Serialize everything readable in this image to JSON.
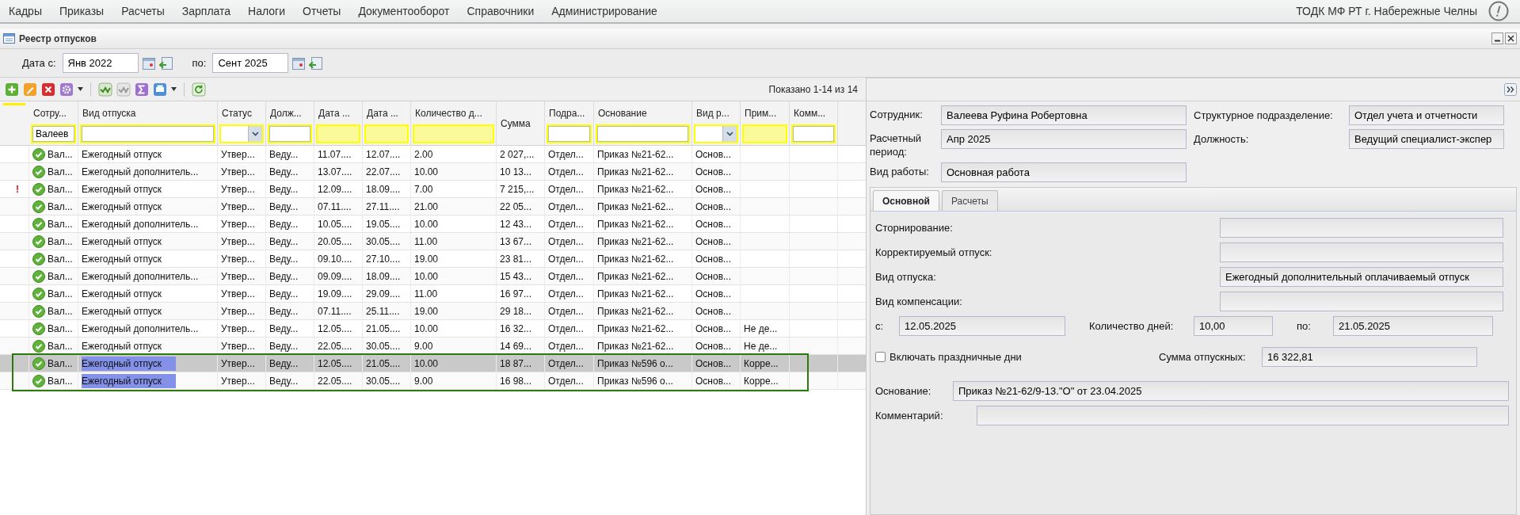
{
  "menu": {
    "items": [
      "Кадры",
      "Приказы",
      "Расчеты",
      "Зарплата",
      "Налоги",
      "Отчеты",
      "Документооборот",
      "Справочники",
      "Администрирование"
    ],
    "organization": "ТОДК МФ РТ г. Набережные Челны"
  },
  "window": {
    "title": "Реестр отпусков"
  },
  "period": {
    "from_label": "Дата с:",
    "from_value": "Янв 2022",
    "to_label": "по:",
    "to_value": "Сент 2025"
  },
  "table": {
    "shown": "Показано 1-14 из 14",
    "columns": [
      {
        "title": "Сотру...",
        "filter": {
          "kind": "text",
          "value": "Валеев"
        }
      },
      {
        "title": "Вид отпуска",
        "filter": {
          "kind": "text"
        }
      },
      {
        "title": "Статус",
        "filter": {
          "kind": "select"
        }
      },
      {
        "title": "Долж...",
        "filter": {
          "kind": "text"
        }
      },
      {
        "title": "Дата ...",
        "filter": {
          "kind": "shaded"
        }
      },
      {
        "title": "Дата ...",
        "filter": {
          "kind": "shaded"
        }
      },
      {
        "title": "Количество д...",
        "filter": {
          "kind": "shaded"
        }
      },
      {
        "title": "Сумма"
      },
      {
        "title": "Подра...",
        "filter": {
          "kind": "text"
        }
      },
      {
        "title": "Основание",
        "filter": {
          "kind": "text"
        }
      },
      {
        "title": "Вид р...",
        "filter": {
          "kind": "select"
        }
      },
      {
        "title": "Прим...",
        "filter": {
          "kind": "shaded"
        }
      },
      {
        "title": "Комм...",
        "filter": {
          "kind": "text"
        }
      }
    ],
    "rows": [
      {
        "selected": false,
        "highlighted": false,
        "framed": false,
        "cells": [
          "Вал...",
          "Ежегодный отпуск",
          "Утвер...",
          "Веду...",
          "11.07....",
          "12.07....",
          "2.00",
          "2 027,...",
          "Отдел...",
          "Приказ №21-62...",
          "Основ..."
        ]
      },
      {
        "selected": false,
        "highlighted": false,
        "framed": false,
        "cells": [
          "Вал...",
          "Ежегодный дополнитель...",
          "Утвер...",
          "Веду...",
          "13.07....",
          "22.07....",
          "10.00",
          "10 13...",
          "Отдел...",
          "Приказ №21-62...",
          "Основ..."
        ]
      },
      {
        "selected": false,
        "highlighted": false,
        "framed": false,
        "marker": "!",
        "cells": [
          "Вал...",
          "Ежегодный отпуск",
          "Утвер...",
          "Веду...",
          "12.09....",
          "18.09....",
          "7.00",
          "7 215,...",
          "Отдел...",
          "Приказ №21-62...",
          "Основ..."
        ]
      },
      {
        "selected": false,
        "highlighted": false,
        "framed": false,
        "cells": [
          "Вал...",
          "Ежегодный отпуск",
          "Утвер...",
          "Веду...",
          "07.11....",
          "27.11....",
          "21.00",
          "22 05...",
          "Отдел...",
          "Приказ №21-62...",
          "Основ..."
        ]
      },
      {
        "selected": false,
        "highlighted": false,
        "framed": false,
        "cells": [
          "Вал...",
          "Ежегодный дополнитель...",
          "Утвер...",
          "Веду...",
          "10.05....",
          "19.05....",
          "10.00",
          "12 43...",
          "Отдел...",
          "Приказ №21-62...",
          "Основ..."
        ]
      },
      {
        "selected": false,
        "highlighted": false,
        "framed": false,
        "cells": [
          "Вал...",
          "Ежегодный отпуск",
          "Утвер...",
          "Веду...",
          "20.05....",
          "30.05....",
          "11.00",
          "13 67...",
          "Отдел...",
          "Приказ №21-62...",
          "Основ..."
        ]
      },
      {
        "selected": false,
        "highlighted": false,
        "framed": false,
        "cells": [
          "Вал...",
          "Ежегодный отпуск",
          "Утвер...",
          "Веду...",
          "09.10....",
          "27.10....",
          "19.00",
          "23 81...",
          "Отдел...",
          "Приказ №21-62...",
          "Основ..."
        ]
      },
      {
        "selected": false,
        "highlighted": false,
        "framed": false,
        "cells": [
          "Вал...",
          "Ежегодный дополнитель...",
          "Утвер...",
          "Веду...",
          "09.09....",
          "18.09....",
          "10.00",
          "15 43...",
          "Отдел...",
          "Приказ №21-62...",
          "Основ..."
        ]
      },
      {
        "selected": false,
        "highlighted": false,
        "framed": false,
        "cells": [
          "Вал...",
          "Ежегодный отпуск",
          "Утвер...",
          "Веду...",
          "19.09....",
          "29.09....",
          "11.00",
          "16 97...",
          "Отдел...",
          "Приказ №21-62...",
          "Основ..."
        ]
      },
      {
        "selected": false,
        "highlighted": false,
        "framed": false,
        "cells": [
          "Вал...",
          "Ежегодный отпуск",
          "Утвер...",
          "Веду...",
          "07.11....",
          "25.11....",
          "19.00",
          "29 18...",
          "Отдел...",
          "Приказ №21-62...",
          "Основ..."
        ]
      },
      {
        "selected": false,
        "highlighted": false,
        "framed": false,
        "cells": [
          "Вал...",
          "Ежегодный дополнитель...",
          "Утвер...",
          "Веду...",
          "12.05....",
          "21.05....",
          "10.00",
          "16 32...",
          "Отдел...",
          "Приказ №21-62...",
          "Основ...",
          "Не де..."
        ]
      },
      {
        "selected": false,
        "highlighted": false,
        "framed": false,
        "cells": [
          "Вал...",
          "Ежегодный отпуск",
          "Утвер...",
          "Веду...",
          "22.05....",
          "30.05....",
          "9.00",
          "14 69...",
          "Отдел...",
          "Приказ №21-62...",
          "Основ...",
          "Не де..."
        ]
      },
      {
        "selected": true,
        "highlighted": true,
        "framed": true,
        "cells": [
          "Вал...",
          "Ежегодный отпуск",
          "Утвер...",
          "Веду...",
          "12.05....",
          "21.05....",
          "10.00",
          "18 87...",
          "Отдел...",
          "Приказ №596 о...",
          "Основ...",
          "Корре..."
        ]
      },
      {
        "selected": false,
        "highlighted": true,
        "framed": true,
        "cells": [
          "Вал...",
          "Ежегодный отпуск",
          "Утвер...",
          "Веду...",
          "22.05....",
          "30.05....",
          "9.00",
          "16 98...",
          "Отдел...",
          "Приказ №596 о...",
          "Основ...",
          "Корре..."
        ]
      }
    ]
  },
  "details": {
    "header": [
      {
        "label": "Сотрудник:",
        "value": "Валеева Руфина Робертовна"
      },
      {
        "label": "Структурное подразделение:",
        "value": "Отдел учета и отчетности"
      },
      {
        "label": "Расчетный период:",
        "value": "Апр 2025"
      },
      {
        "label": "Должность:",
        "value": "Ведущий специалист-экспер"
      },
      {
        "label": "Вид работы:",
        "value": "Основная работа"
      }
    ],
    "tabs": [
      {
        "label": "Основной",
        "selected": true
      },
      {
        "label": "Расчеты",
        "selected": false
      }
    ],
    "fields": [
      {
        "label": "Сторнирование:"
      },
      {
        "label": "Корректируемый отпуск:"
      },
      {
        "label": "Вид отпуска:",
        "value": "Ежегодный дополнительный оплачиваемый отпуск"
      },
      {
        "label": "Вид компенсации:"
      }
    ],
    "start": {
      "label": "с:",
      "value": "12.05.2025"
    },
    "days": {
      "label": "Количество дней:",
      "value": "10,00"
    },
    "end": {
      "label": "по:",
      "value": "21.05.2025"
    },
    "holidays": {
      "label": "Включать праздничные дни",
      "checked": false
    },
    "amount": {
      "label": "Сумма отпускных:",
      "value": "16 322,81"
    },
    "basis": {
      "label": "Основание:",
      "value": "Приказ №21-62/9-13.\"О\" от 23.04.2025"
    },
    "comment": {
      "label": "Комментарий:"
    }
  }
}
